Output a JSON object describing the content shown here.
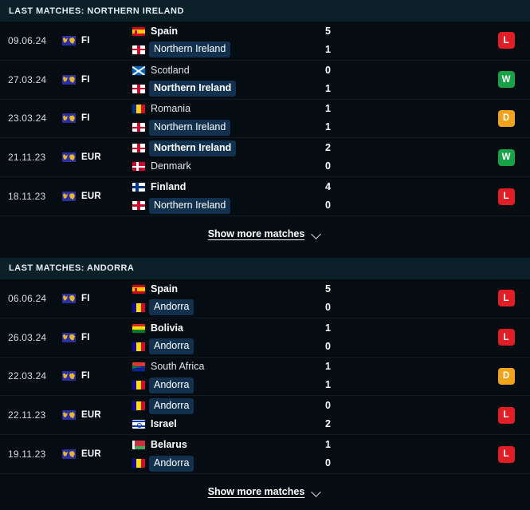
{
  "sections": [
    {
      "header": "LAST MATCHES: NORTHERN IRELAND",
      "highlight_team": "Northern Ireland",
      "show_more_label": "Show more matches",
      "matches": [
        {
          "date": "09.06.24",
          "competition": "FI",
          "competition_icon": "world-map-icon",
          "home_team": "Spain",
          "home_flag": "spain",
          "home_score": "5",
          "home_winner": true,
          "away_team": "Northern Ireland",
          "away_flag": "ni",
          "away_score": "1",
          "away_winner": false,
          "result": "L"
        },
        {
          "date": "27.03.24",
          "competition": "FI",
          "competition_icon": "world-map-icon",
          "home_team": "Scotland",
          "home_flag": "scotland",
          "home_score": "0",
          "home_winner": false,
          "away_team": "Northern Ireland",
          "away_flag": "ni",
          "away_score": "1",
          "away_winner": true,
          "result": "W"
        },
        {
          "date": "23.03.24",
          "competition": "FI",
          "competition_icon": "world-map-icon",
          "home_team": "Romania",
          "home_flag": "romania",
          "home_score": "1",
          "home_winner": false,
          "away_team": "Northern Ireland",
          "away_flag": "ni",
          "away_score": "1",
          "away_winner": false,
          "result": "D"
        },
        {
          "date": "21.11.23",
          "competition": "EUR",
          "competition_icon": "world-map-icon",
          "home_team": "Northern Ireland",
          "home_flag": "ni",
          "home_score": "2",
          "home_winner": true,
          "away_team": "Denmark",
          "away_flag": "denmark",
          "away_score": "0",
          "away_winner": false,
          "result": "W"
        },
        {
          "date": "18.11.23",
          "competition": "EUR",
          "competition_icon": "world-map-icon",
          "home_team": "Finland",
          "home_flag": "finland",
          "home_score": "4",
          "home_winner": true,
          "away_team": "Northern Ireland",
          "away_flag": "ni",
          "away_score": "0",
          "away_winner": false,
          "result": "L"
        }
      ]
    },
    {
      "header": "LAST MATCHES: ANDORRA",
      "highlight_team": "Andorra",
      "show_more_label": "Show more matches",
      "matches": [
        {
          "date": "06.06.24",
          "competition": "FI",
          "competition_icon": "world-map-icon",
          "home_team": "Spain",
          "home_flag": "spain",
          "home_score": "5",
          "home_winner": true,
          "away_team": "Andorra",
          "away_flag": "andorra",
          "away_score": "0",
          "away_winner": false,
          "result": "L"
        },
        {
          "date": "26.03.24",
          "competition": "FI",
          "competition_icon": "world-map-icon",
          "home_team": "Bolivia",
          "home_flag": "bolivia",
          "home_score": "1",
          "home_winner": true,
          "away_team": "Andorra",
          "away_flag": "andorra",
          "away_score": "0",
          "away_winner": false,
          "result": "L"
        },
        {
          "date": "22.03.24",
          "competition": "FI",
          "competition_icon": "world-map-icon",
          "home_team": "South Africa",
          "home_flag": "southafrica",
          "home_score": "1",
          "home_winner": false,
          "away_team": "Andorra",
          "away_flag": "andorra",
          "away_score": "1",
          "away_winner": false,
          "result": "D"
        },
        {
          "date": "22.11.23",
          "competition": "EUR",
          "competition_icon": "world-map-icon",
          "home_team": "Andorra",
          "home_flag": "andorra",
          "home_score": "0",
          "home_winner": false,
          "away_team": "Israel",
          "away_flag": "israel",
          "away_score": "2",
          "away_winner": true,
          "result": "L"
        },
        {
          "date": "19.11.23",
          "competition": "EUR",
          "competition_icon": "world-map-icon",
          "home_team": "Belarus",
          "home_flag": "belarus",
          "home_score": "1",
          "home_winner": true,
          "away_team": "Andorra",
          "away_flag": "andorra",
          "away_score": "0",
          "away_winner": false,
          "result": "L"
        }
      ]
    }
  ],
  "colors": {
    "win": "#19a148",
    "loss": "#e01e26",
    "draw": "#f0a31b",
    "header_bg": "#0c2029",
    "page_bg": "#050d12",
    "highlight_pill": "#12314e"
  }
}
